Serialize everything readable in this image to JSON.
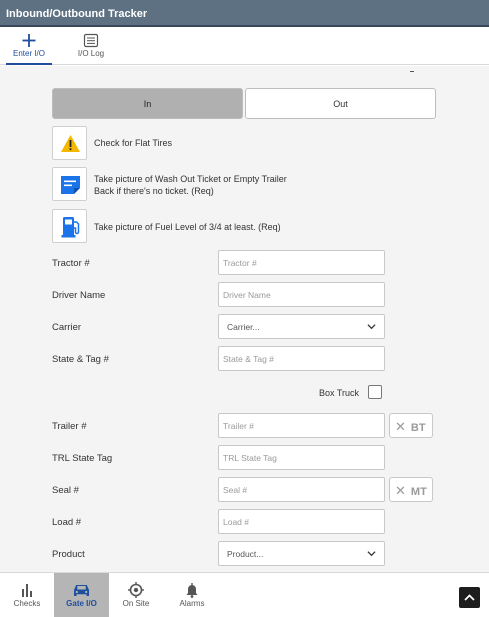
{
  "app": {
    "title": "Inbound/Outbound Tracker"
  },
  "top_nav": [
    {
      "label": "Enter I/O",
      "icon": "plus-icon",
      "active": true
    },
    {
      "label": "I/O Log",
      "icon": "list-icon",
      "active": false
    }
  ],
  "direction": {
    "in_label": "In",
    "out_label": "Out",
    "selected": "In"
  },
  "checks": [
    {
      "icon": "warning-icon",
      "text": "Check for Flat Tires"
    },
    {
      "icon": "note-icon",
      "line1": "Take picture of Wash Out Ticket or Empty Trailer",
      "line2": "Back if there's no ticket. (Req)"
    },
    {
      "icon": "fuel-icon",
      "text": "Take picture of Fuel Level of 3/4 at least. (Req)"
    }
  ],
  "fields": {
    "tractor": {
      "label": "Tractor #",
      "placeholder": "Tractor #"
    },
    "driver": {
      "label": "Driver Name",
      "placeholder": "Driver Name"
    },
    "carrier": {
      "label": "Carrier",
      "value": "Carrier..."
    },
    "state_tag": {
      "label": "State & Tag #",
      "placeholder": "State & Tag #"
    },
    "box_truck": {
      "label": "Box Truck",
      "checked": false
    },
    "trailer": {
      "label": "Trailer #",
      "placeholder": "Trailer #",
      "button": "BT"
    },
    "trl_state_tag": {
      "label": "TRL State Tag",
      "placeholder": "TRL State Tag"
    },
    "seal": {
      "label": "Seal #",
      "placeholder": "Seal #",
      "button": "MT"
    },
    "load": {
      "label": "Load #",
      "placeholder": "Load #"
    },
    "product": {
      "label": "Product",
      "value": "Product..."
    }
  },
  "bottom_nav": [
    {
      "label": "Checks",
      "icon": "bar-chart-icon",
      "active": false
    },
    {
      "label": "Gate I/O",
      "icon": "car-icon",
      "active": true
    },
    {
      "label": "On Site",
      "icon": "location-target-icon",
      "active": false
    },
    {
      "label": "Alarms",
      "icon": "bell-icon",
      "active": false
    }
  ],
  "colors": {
    "titlebar": "#5d7182",
    "accent": "#1f4e9c",
    "warning": "#f5b800",
    "note_blue": "#1a73e8"
  }
}
